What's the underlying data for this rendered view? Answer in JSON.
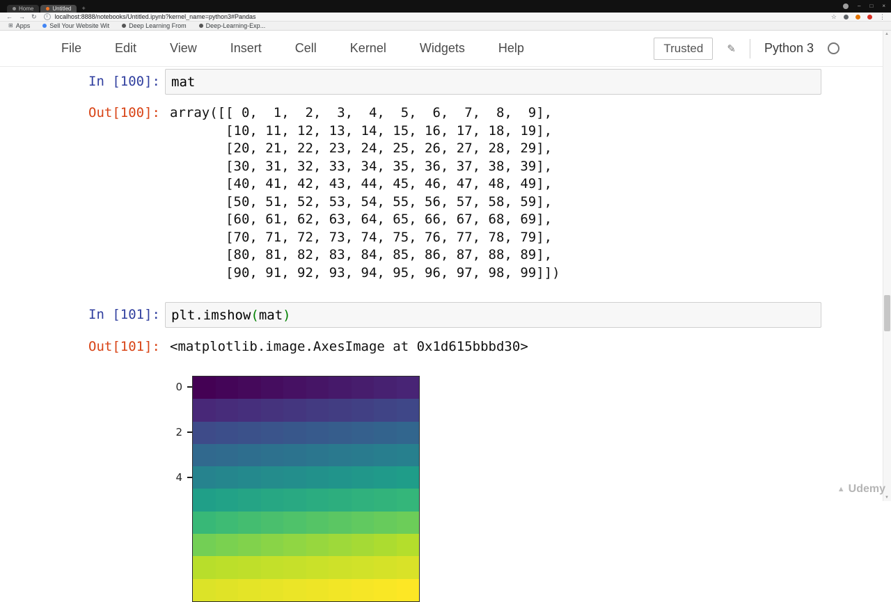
{
  "browser": {
    "tabs": [
      {
        "label": "Home",
        "active": false,
        "icon": "home-favicon",
        "favicon_color": "#8f8f8f"
      },
      {
        "label": "Untitled",
        "active": true,
        "icon": "jupyter-favicon",
        "favicon_color": "#f37626"
      }
    ],
    "url": "localhost:8888/notebooks/Untitled.ipynb?kernel_name=python3#Pandas",
    "bookmarks": [
      {
        "label": "Apps",
        "icon": "apps-grid-icon",
        "icon_color": "#5f6368"
      },
      {
        "label": "Sell Your Website Wit",
        "icon": "site-favicon",
        "icon_color": "#4285f4"
      },
      {
        "label": "Deep Learning From",
        "icon": "site-favicon",
        "icon_color": "#555555"
      },
      {
        "label": "Deep-Learning-Exp...",
        "icon": "site-favicon",
        "icon_color": "#555555"
      }
    ]
  },
  "icons": {
    "back": "←",
    "forward": "→",
    "refresh": "↻",
    "info": "i",
    "star": "☆",
    "menu": "⋮",
    "new_tab": "+",
    "minimize": "–",
    "maximize": "□",
    "close": "×",
    "pencil": "✎",
    "scroll_up": "▲",
    "scroll_down": "▼",
    "udemy_logo": "▲"
  },
  "jupyter": {
    "menu_items": [
      "File",
      "Edit",
      "View",
      "Insert",
      "Cell",
      "Kernel",
      "Widgets",
      "Help"
    ],
    "trusted_label": "Trusted",
    "kernel_name": "Python 3"
  },
  "cells": {
    "in100_label": "In [100]:",
    "in100_code": "mat",
    "out100_label": "Out[100]:",
    "out100_text": "array([[ 0,  1,  2,  3,  4,  5,  6,  7,  8,  9],\n       [10, 11, 12, 13, 14, 15, 16, 17, 18, 19],\n       [20, 21, 22, 23, 24, 25, 26, 27, 28, 29],\n       [30, 31, 32, 33, 34, 35, 36, 37, 38, 39],\n       [40, 41, 42, 43, 44, 45, 46, 47, 48, 49],\n       [50, 51, 52, 53, 54, 55, 56, 57, 58, 59],\n       [60, 61, 62, 63, 64, 65, 66, 67, 68, 69],\n       [70, 71, 72, 73, 74, 75, 76, 77, 78, 79],\n       [80, 81, 82, 83, 84, 85, 86, 87, 88, 89],\n       [90, 91, 92, 93, 94, 95, 96, 97, 98, 99]])",
    "in101_label": "In [101]:",
    "in101_code": {
      "func": "plt.imshow",
      "open": "(",
      "arg": "mat",
      "close": ")"
    },
    "out101_label": "Out[101]:",
    "out101_text": "<matplotlib.image.AxesImage at 0x1d615bbbd30>"
  },
  "chart_data": {
    "type": "heatmap",
    "title": "",
    "xlabel": "",
    "ylabel": "",
    "colormap": "viridis",
    "value_range": [
      0,
      99
    ],
    "matrix": [
      [
        0,
        1,
        2,
        3,
        4,
        5,
        6,
        7,
        8,
        9
      ],
      [
        10,
        11,
        12,
        13,
        14,
        15,
        16,
        17,
        18,
        19
      ],
      [
        20,
        21,
        22,
        23,
        24,
        25,
        26,
        27,
        28,
        29
      ],
      [
        30,
        31,
        32,
        33,
        34,
        35,
        36,
        37,
        38,
        39
      ],
      [
        40,
        41,
        42,
        43,
        44,
        45,
        46,
        47,
        48,
        49
      ],
      [
        50,
        51,
        52,
        53,
        54,
        55,
        56,
        57,
        58,
        59
      ],
      [
        60,
        61,
        62,
        63,
        64,
        65,
        66,
        67,
        68,
        69
      ],
      [
        70,
        71,
        72,
        73,
        74,
        75,
        76,
        77,
        78,
        79
      ],
      [
        80,
        81,
        82,
        83,
        84,
        85,
        86,
        87,
        88,
        89
      ],
      [
        90,
        91,
        92,
        93,
        94,
        95,
        96,
        97,
        98,
        99
      ]
    ],
    "colormap_stops": [
      {
        "t": 0.0,
        "c": "#440154"
      },
      {
        "t": 0.1,
        "c": "#482878"
      },
      {
        "t": 0.2,
        "c": "#3e4a89"
      },
      {
        "t": 0.3,
        "c": "#31688e"
      },
      {
        "t": 0.4,
        "c": "#26828e"
      },
      {
        "t": 0.5,
        "c": "#1f9e89"
      },
      {
        "t": 0.6,
        "c": "#35b779"
      },
      {
        "t": 0.7,
        "c": "#6ece58"
      },
      {
        "t": 0.8,
        "c": "#b5de2b"
      },
      {
        "t": 1.0,
        "c": "#fde725"
      }
    ],
    "yticks": [
      {
        "label": "0",
        "row": 0
      },
      {
        "label": "2",
        "row": 2
      },
      {
        "label": "4",
        "row": 4
      }
    ]
  },
  "watermark": {
    "label": "Udemy"
  }
}
